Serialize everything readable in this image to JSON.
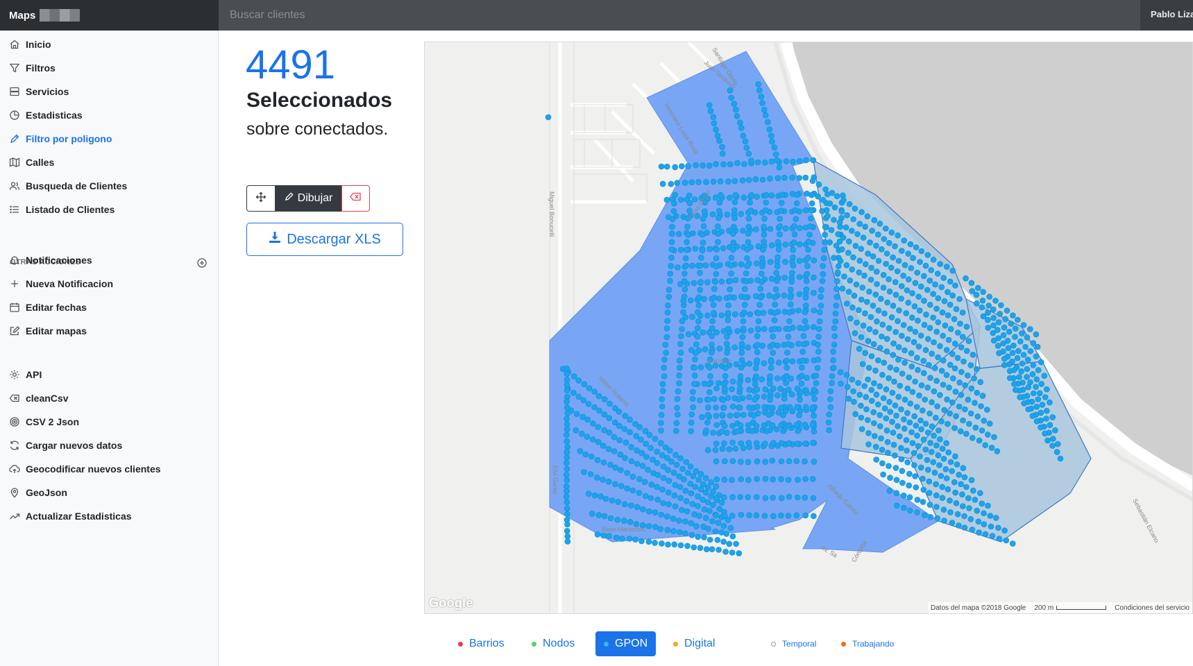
{
  "app": {
    "brand": "Maps"
  },
  "search": {
    "placeholder": "Buscar clientes"
  },
  "user": {
    "name": "Pablo Liza"
  },
  "sidebar": {
    "items": [
      {
        "label": "Inicio",
        "icon": "home-icon"
      },
      {
        "label": "Filtros",
        "icon": "filter-icon"
      },
      {
        "label": "Servicios",
        "icon": "server-icon"
      },
      {
        "label": "Estadisticas",
        "icon": "pie-chart-icon"
      },
      {
        "label": "Filtro por poligono",
        "icon": "pencil-icon",
        "active": true
      },
      {
        "label": "Calles",
        "icon": "map-icon"
      },
      {
        "label": "Busqueda de Clientes",
        "icon": "users-icon"
      },
      {
        "label": "Listado de Clientes",
        "icon": "list-icon"
      }
    ],
    "section_title": "OTRAS ACCIONES",
    "other": [
      {
        "label": "Notificaciones",
        "icon": "bell-icon"
      },
      {
        "label": "Nueva Notificacion",
        "icon": "plus-icon"
      },
      {
        "label": "Editar fechas",
        "icon": "calendar-icon"
      },
      {
        "label": "Editar mapas",
        "icon": "edit-icon"
      }
    ],
    "tools": [
      {
        "label": "API",
        "icon": "gear-icon"
      },
      {
        "label": "cleanCsv",
        "icon": "backspace-icon"
      },
      {
        "label": "CSV 2 Json",
        "icon": "target-icon"
      },
      {
        "label": "Cargar nuevos datos",
        "icon": "refresh-icon"
      },
      {
        "label": "Geocodificar nuevos clientes",
        "icon": "cloud-upload-icon"
      },
      {
        "label": "GeoJson",
        "icon": "map-pin-icon"
      },
      {
        "label": "Actualizar Estadisticas",
        "icon": "trending-up-icon"
      }
    ]
  },
  "selection": {
    "count": "4491",
    "title": "Seleccionados",
    "subtitle": "sobre conectados."
  },
  "toolbar": {
    "draw_label": "Dibujar",
    "download_label": "Descargar XLS"
  },
  "map": {
    "google_logo": "Google",
    "attribution": "Datos del mapa ©2018 Google",
    "scale": "200 m",
    "terms": "Condiciones del servicio",
    "street_labels": [
      "Juan Senkovic",
      "Santiago Oleda",
      "Hermana Luisa Rosa",
      "Miguel Bonucelli",
      "Base Marambio",
      "Av. Sa",
      "Córdoba",
      "Sebastián Elcano",
      "Alfredo Galvez",
      "Milton Roberts",
      "Elvi Garay",
      "Camblor",
      "Rosa Delich"
    ],
    "colors": {
      "polygon": "#6ea0f5",
      "polygon_selected": "#a9c6dc",
      "dot": "#1ca3ec",
      "water": "#cfcfcf"
    }
  },
  "legend": [
    {
      "label": "Barrios",
      "color": "#e83e4a",
      "active": false
    },
    {
      "label": "Nodos",
      "color": "#4cd964",
      "active": false
    },
    {
      "label": "GPON",
      "color": "#3ab8f5",
      "active": true
    },
    {
      "label": "Digital",
      "color": "#f5a623",
      "active": false
    }
  ],
  "legend_small": [
    {
      "label": "Temporal",
      "color": "#ffffff"
    },
    {
      "label": "Trabajando",
      "color": "#f06a24"
    }
  ]
}
